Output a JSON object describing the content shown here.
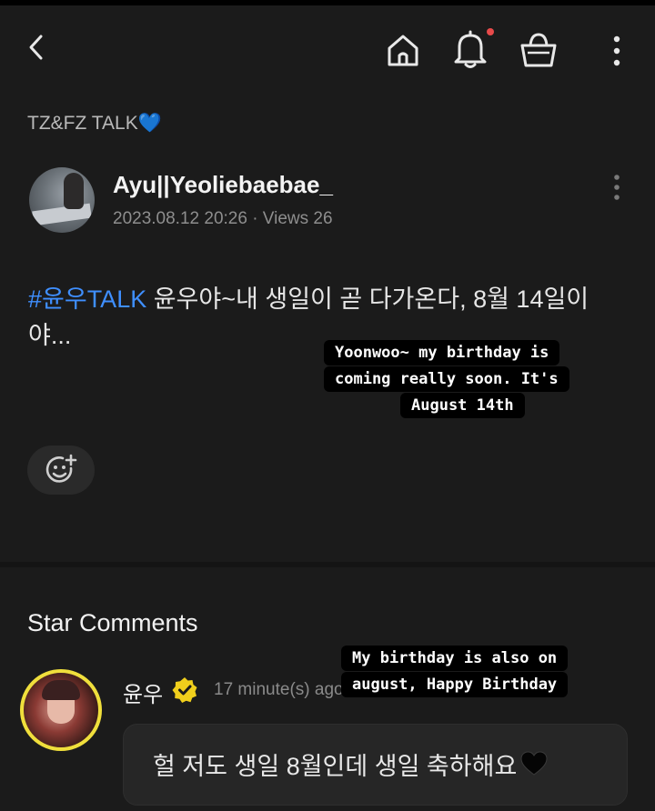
{
  "colors": {
    "background": "#1b1b1b",
    "hashtag": "#3f8fff",
    "notification_dot": "#e84a4a",
    "verified_badge": "#f0cf1c",
    "avatar_ring": "#f0df3c"
  },
  "topbar": {
    "icons": [
      "back-icon",
      "home-icon",
      "bell-icon",
      "shopping-bag-icon",
      "more-vertical-icon"
    ],
    "has_notification": true
  },
  "board": {
    "title": "TZ&FZ TALK",
    "emoji": "💙"
  },
  "post": {
    "author": "Ayu||Yeoliebaebae_",
    "date": "2023.08.12 20:26",
    "views_label": "· Views 26",
    "hashtag": "#윤우TALK",
    "body_text": " 윤우야~내 생일이 곧 다가온다, 8월 14일이야..."
  },
  "translation_captions": {
    "post": [
      "Yoonwoo~ my birthday is",
      "coming really soon. It's",
      "August 14th"
    ],
    "comment": [
      "My birthday is also on",
      "august, Happy Birthday"
    ]
  },
  "reaction_button": {
    "icon": "add-emoji-icon"
  },
  "star_comments": {
    "section_title": "Star Comments",
    "items": [
      {
        "name": "윤우",
        "verified": true,
        "time": "17 minute(s) ago",
        "text": "헐 저도 생일 8월인데 생일 축하해요",
        "emoji": "black-heart"
      }
    ]
  }
}
